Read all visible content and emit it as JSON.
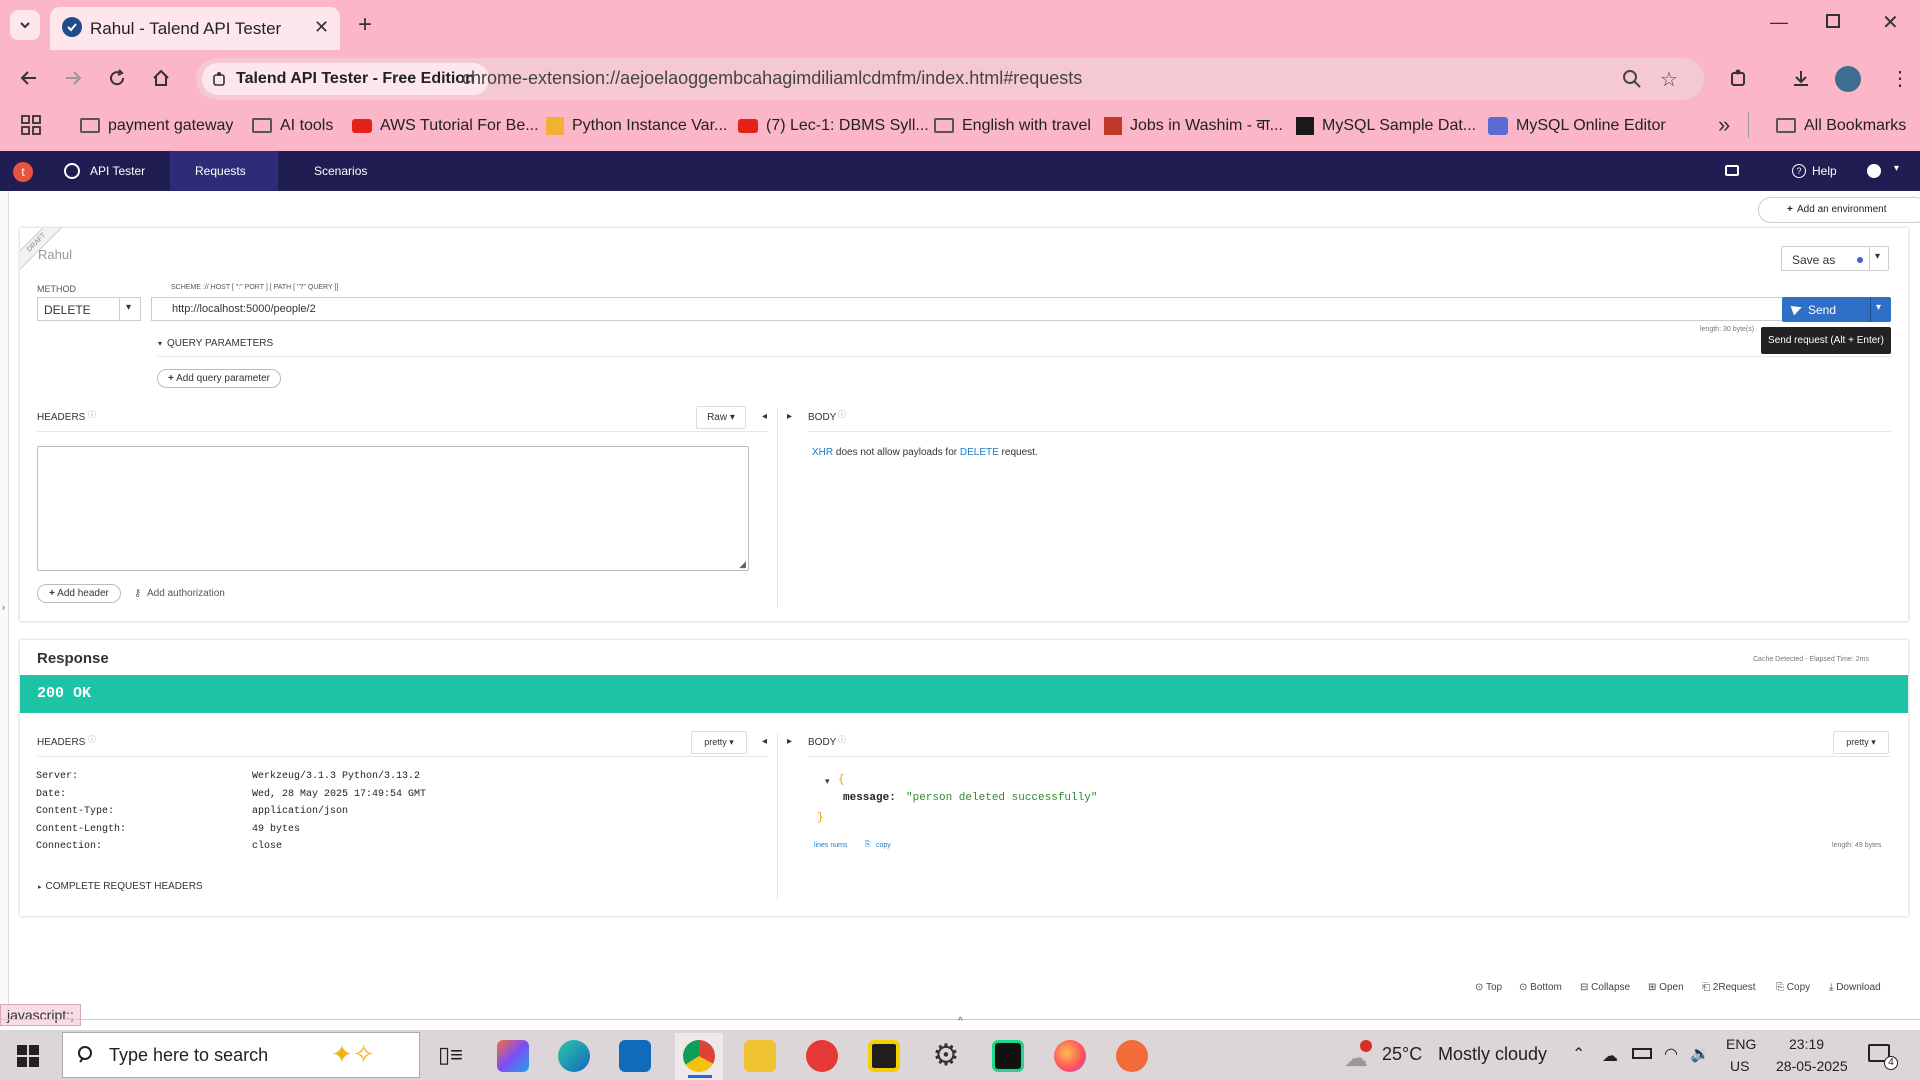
{
  "browser": {
    "tab_title": "Rahul - Talend API Tester",
    "site_chip": "Talend API Tester - Free Edition",
    "url": "chrome-extension://aejoelaoggembcahagimdiliamlcdmfm/index.html#requests",
    "bookmarks": [
      {
        "label": "payment gateway",
        "icon": "folder-icon"
      },
      {
        "label": "AI tools",
        "icon": "folder-icon"
      },
      {
        "label": "AWS Tutorial For Be...",
        "icon": "youtube-icon"
      },
      {
        "label": "Python Instance Var...",
        "icon": "site-icon"
      },
      {
        "label": "(7) Lec-1: DBMS Syll...",
        "icon": "youtube-icon"
      },
      {
        "label": "English with travel",
        "icon": "folder-icon"
      },
      {
        "label": "Jobs in Washim - वा...",
        "icon": "site-icon"
      },
      {
        "label": "MySQL Sample Dat...",
        "icon": "site-icon"
      },
      {
        "label": "MySQL Online Editor",
        "icon": "site-icon"
      }
    ],
    "all_bookmarks": "All Bookmarks",
    "status_url": "javascript:;"
  },
  "app": {
    "nav": {
      "brand": "API Tester",
      "requests": "Requests",
      "scenarios": "Scenarios",
      "help": "Help"
    },
    "add_environment": "Add an environment",
    "request": {
      "ribbon": "DRAFT",
      "name": "Rahul",
      "save_as": "Save as",
      "method_label": "METHOD",
      "method": "DELETE",
      "url_label": "SCHEME :// HOST [ \":\" PORT ] [ PATH [ \"?\" QUERY ]]",
      "url": "http://localhost:5000/people/2",
      "send": "Send",
      "length": "length: 30 byte(s)",
      "tooltip": "Send request (Alt + Enter)",
      "query_params": "QUERY PARAMETERS",
      "add_query_param": "Add query parameter",
      "headers": "HEADERS",
      "raw": "Raw",
      "body": "BODY",
      "body_msg_xhr": "XHR",
      "body_msg_mid": " does not allow payloads for ",
      "body_msg_method": "DELETE",
      "body_msg_end": " request.",
      "add_header": "Add header",
      "add_authorization": "Add authorization"
    },
    "response": {
      "title": "Response",
      "cache": "Cache Detected - Elapsed Time: 2ms",
      "status": "200 OK",
      "status_color": "#1cc3a5",
      "headers_label": "HEADERS",
      "pretty": "pretty",
      "body_label": "BODY",
      "headers": [
        {
          "name": "Server:",
          "value": "Werkzeug/3.1.3 Python/3.13.2"
        },
        {
          "name": "Date:",
          "value": "Wed, 28 May 2025 17:49:54 GMT"
        },
        {
          "name": "Content-Type:",
          "value": "application/json"
        },
        {
          "name": "Content-Length:",
          "value": "49 bytes"
        },
        {
          "name": "Connection:",
          "value": "close"
        }
      ],
      "complete_headers": "COMPLETE REQUEST HEADERS",
      "json_open": "{",
      "json_key": "message:",
      "json_value": "\"person deleted successfully\"",
      "json_close": "}",
      "lines_nums": "lines nums",
      "copy": "copy",
      "length": "length: 49 bytes"
    },
    "footer": [
      "Top",
      "Bottom",
      "Collapse",
      "Open",
      "2Request",
      "Copy",
      "Download"
    ]
  },
  "taskbar": {
    "search_placeholder": "Type here to search",
    "temperature": "25°C",
    "weather": "Mostly cloudy",
    "lang1": "ENG",
    "lang2": "US",
    "time": "23:19",
    "date": "28-05-2025",
    "notif_count": "4"
  }
}
